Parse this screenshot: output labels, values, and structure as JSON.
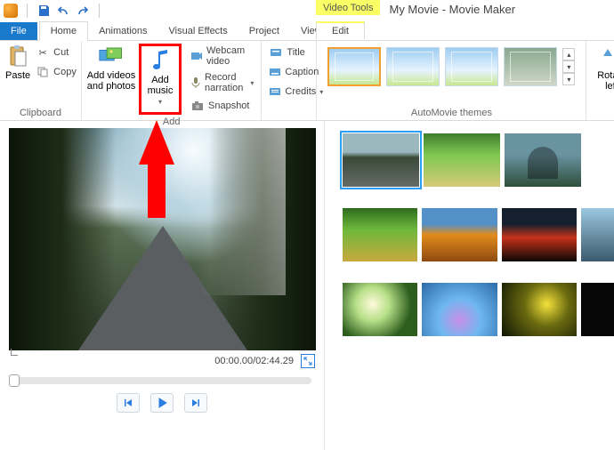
{
  "title": "My Movie - Movie Maker",
  "context_tab": "Video Tools",
  "edit_tab": "Edit",
  "tabs": {
    "file": "File",
    "home": "Home",
    "anim": "Animations",
    "vfx": "Visual Effects",
    "project": "Project",
    "view": "View"
  },
  "clipboard": {
    "label": "Clipboard",
    "paste": "Paste",
    "cut": "Cut",
    "copy": "Copy"
  },
  "add": {
    "label": "Add",
    "addvid": "Add videos\nand photos",
    "addmusic": "Add\nmusic",
    "webcam": "Webcam video",
    "narr": "Record narration",
    "snap": "Snapshot",
    "title": "Title",
    "caption": "Caption",
    "credits": "Credits"
  },
  "themes": {
    "label": "AutoMovie themes"
  },
  "rotate": {
    "left": "Rotate\nleft"
  },
  "time": "00:00.00/02:44.29"
}
